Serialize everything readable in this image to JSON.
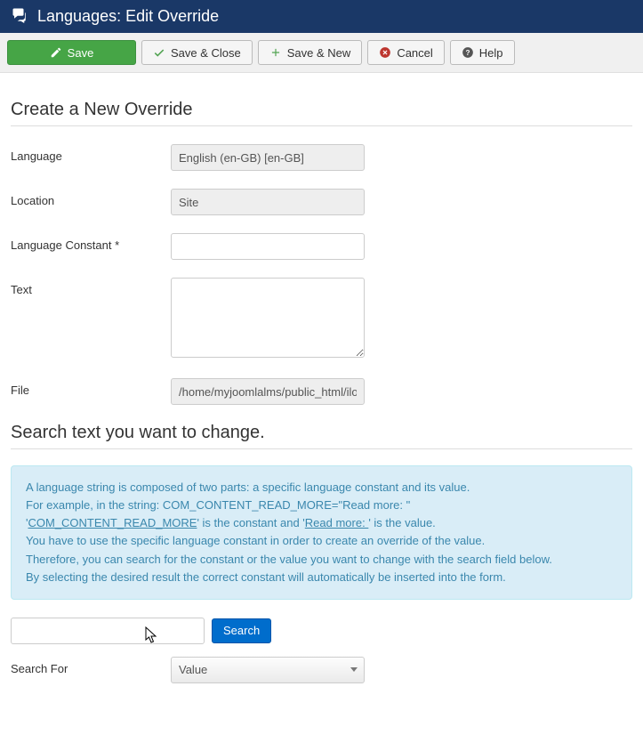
{
  "header": {
    "title": "Languages: Edit Override"
  },
  "toolbar": {
    "save": "Save",
    "save_close": "Save & Close",
    "save_new": "Save & New",
    "cancel": "Cancel",
    "help": "Help"
  },
  "section1": {
    "title": "Create a New Override",
    "labels": {
      "language": "Language",
      "location": "Location",
      "constant": "Language Constant *",
      "text": "Text",
      "file": "File"
    },
    "values": {
      "language": "English (en-GB) [en-GB]",
      "location": "Site",
      "constant": "",
      "text": "",
      "file": "/home/myjoomlalms/public_html/ilor"
    }
  },
  "section2": {
    "title": "Search text you want to change.",
    "info": {
      "line1": "A language string is composed of two parts: a specific language constant and its value.",
      "line2a": "For example, in the string: COM_CONTENT_READ_MORE=\"Read more: \"",
      "line3a": "'",
      "line3_link1": "COM_CONTENT_READ_MORE",
      "line3b": "' is the constant and '",
      "line3_link2": "Read more: ",
      "line3c": "' is the value.",
      "line4": "You have to use the specific language constant in order to create an override of the value.",
      "line5": "Therefore, you can search for the constant or the value you want to change with the search field below.",
      "line6": "By selecting the desired result the correct constant will automatically be inserted into the form."
    },
    "search_value": "",
    "search_button": "Search",
    "search_for_label": "Search For",
    "search_for_value": "Value"
  }
}
